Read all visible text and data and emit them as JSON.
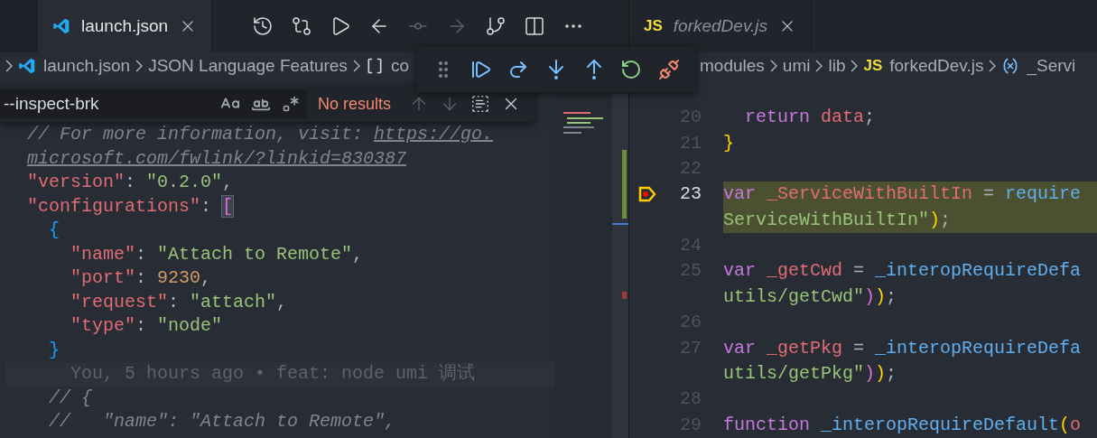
{
  "left_editor": {
    "tabs": [
      {
        "label": "launch.json",
        "selected": true,
        "preview": false
      }
    ],
    "actions": [
      {
        "kind": "history",
        "disabled": false
      },
      {
        "kind": "compare",
        "disabled": false
      },
      {
        "kind": "run",
        "disabled": false
      },
      {
        "kind": "back",
        "disabled": false
      },
      {
        "kind": "commit",
        "disabled": true
      },
      {
        "kind": "forward",
        "disabled": true
      },
      {
        "kind": "branch",
        "disabled": false
      },
      {
        "kind": "split",
        "disabled": false
      },
      {
        "kind": "more",
        "disabled": false
      }
    ],
    "breadcrumbs": [
      {
        "label": "launch.json",
        "kind": "file"
      },
      {
        "label": "JSON Language Features",
        "kind": "section"
      },
      {
        "label": "co",
        "kind": "symbol"
      }
    ],
    "find": {
      "value": "--inspect-brk",
      "match_case": false,
      "whole_word": false,
      "regex": false,
      "message": "No results",
      "prev_disabled": true,
      "next_disabled": true
    },
    "lines": [
      {
        "tokens": [
          {
            "kind": "comment",
            "text": "// For more information, visit: "
          },
          {
            "kind": "link",
            "text": "https://go."
          }
        ]
      },
      {
        "tokens": [
          {
            "kind": "link",
            "text": "microsoft.com/fwlink/?linkid=830387"
          }
        ]
      },
      {
        "tokens": [
          {
            "kind": "key",
            "text": "\"version\""
          },
          {
            "kind": "punct",
            "text": ": "
          },
          {
            "kind": "string",
            "text": "\"0.2.0\""
          },
          {
            "kind": "punct",
            "text": ","
          }
        ]
      },
      {
        "tokens": [
          {
            "kind": "key",
            "text": "\"configurations\""
          },
          {
            "kind": "punct",
            "text": ": "
          },
          {
            "kind": "match",
            "text": "["
          }
        ]
      },
      {
        "tokens": [
          {
            "kind": "brace",
            "text": "  {"
          }
        ]
      },
      {
        "tokens": [
          {
            "kind": "key",
            "text": "    \"name\""
          },
          {
            "kind": "punct",
            "text": ": "
          },
          {
            "kind": "string",
            "text": "\"Attach to Remote\""
          },
          {
            "kind": "punct",
            "text": ","
          }
        ]
      },
      {
        "tokens": [
          {
            "kind": "key",
            "text": "    \"port\""
          },
          {
            "kind": "punct",
            "text": ": "
          },
          {
            "kind": "number",
            "text": "9230"
          },
          {
            "kind": "punct",
            "text": ","
          }
        ]
      },
      {
        "tokens": [
          {
            "kind": "key",
            "text": "    \"request\""
          },
          {
            "kind": "punct",
            "text": ": "
          },
          {
            "kind": "string",
            "text": "\"attach\""
          },
          {
            "kind": "punct",
            "text": ","
          }
        ]
      },
      {
        "tokens": [
          {
            "kind": "key",
            "text": "    \"type\""
          },
          {
            "kind": "punct",
            "text": ": "
          },
          {
            "kind": "string",
            "text": "\"node\""
          }
        ]
      },
      {
        "tokens": [
          {
            "kind": "brace",
            "text": "  }"
          }
        ]
      },
      {
        "tokens": [
          {
            "kind": "blame",
            "text": "    You, 5 hours ago • feat: node umi 调试"
          }
        ]
      },
      {
        "tokens": [
          {
            "kind": "comment",
            "text": "  // {"
          }
        ]
      },
      {
        "tokens": [
          {
            "kind": "comment",
            "text": "  //   \"name\": \"Attach to Remote\","
          }
        ]
      }
    ]
  },
  "debug_toolbar": [
    {
      "kind": "grip"
    },
    {
      "kind": "continue"
    },
    {
      "kind": "step_over"
    },
    {
      "kind": "step_into"
    },
    {
      "kind": "step_out"
    },
    {
      "kind": "restart"
    },
    {
      "kind": "disconnect"
    }
  ],
  "right_editor": {
    "tabs": [
      {
        "label": "forkedDev.js",
        "selected": false,
        "preview": true,
        "icon_text": "JS"
      }
    ],
    "breadcrumbs": [
      {
        "label": "modules",
        "kind": "folder"
      },
      {
        "label": "umi",
        "kind": "folder"
      },
      {
        "label": "lib",
        "kind": "folder"
      },
      {
        "label": "forkedDev.js",
        "kind": "file",
        "icon_text": "JS"
      },
      {
        "label": "_Servi",
        "kind": "symbol"
      }
    ],
    "lines": [
      {
        "number": "20",
        "current": false,
        "rows": [
          {
            "tokens": [
              {
                "kind": "keyword",
                "text": "  return "
              },
              {
                "kind": "var",
                "text": "data"
              },
              {
                "kind": "punct",
                "text": ";"
              }
            ]
          }
        ]
      },
      {
        "number": "21",
        "current": false,
        "rows": [
          {
            "tokens": [
              {
                "kind": "bracket",
                "text": "}"
              }
            ]
          }
        ]
      },
      {
        "number": "22",
        "current": false,
        "rows": [
          {
            "tokens": []
          }
        ]
      },
      {
        "number": "23",
        "current": true,
        "breakpoint": true,
        "rows": [
          {
            "tokens": [
              {
                "kind": "keyword",
                "text": "var "
              },
              {
                "kind": "var",
                "text": "_ServiceWithBuiltIn"
              },
              {
                "kind": "punct",
                "text": " = "
              },
              {
                "kind": "func",
                "text": "require"
              }
            ]
          },
          {
            "tokens": [
              {
                "kind": "string",
                "text": "ServiceWithBuiltIn\""
              },
              {
                "kind": "bracket",
                "text": ")"
              },
              {
                "kind": "punct",
                "text": ";"
              }
            ]
          }
        ]
      },
      {
        "number": "24",
        "current": false,
        "rows": [
          {
            "tokens": []
          }
        ]
      },
      {
        "number": "25",
        "current": false,
        "rows": [
          {
            "tokens": [
              {
                "kind": "keyword",
                "text": "var "
              },
              {
                "kind": "var",
                "text": "_getCwd"
              },
              {
                "kind": "punct",
                "text": " = "
              },
              {
                "kind": "func",
                "text": "_interopRequireDefa"
              }
            ]
          },
          {
            "tokens": [
              {
                "kind": "string",
                "text": "utils/getCwd\""
              },
              {
                "kind": "bracket2",
                "text": ")"
              },
              {
                "kind": "bracket",
                "text": ")"
              },
              {
                "kind": "punct",
                "text": ";"
              }
            ]
          }
        ]
      },
      {
        "number": "26",
        "current": false,
        "rows": [
          {
            "tokens": []
          }
        ]
      },
      {
        "number": "27",
        "current": false,
        "rows": [
          {
            "tokens": [
              {
                "kind": "keyword",
                "text": "var "
              },
              {
                "kind": "var",
                "text": "_getPkg"
              },
              {
                "kind": "punct",
                "text": " = "
              },
              {
                "kind": "func",
                "text": "_interopRequireDefa"
              }
            ]
          },
          {
            "tokens": [
              {
                "kind": "string",
                "text": "utils/getPkg\""
              },
              {
                "kind": "bracket2",
                "text": ")"
              },
              {
                "kind": "bracket",
                "text": ")"
              },
              {
                "kind": "punct",
                "text": ";"
              }
            ]
          }
        ]
      },
      {
        "number": "28",
        "current": false,
        "rows": [
          {
            "tokens": []
          }
        ]
      },
      {
        "number": "29",
        "current": false,
        "rows": [
          {
            "tokens": [
              {
                "kind": "keyword",
                "text": "function "
              },
              {
                "kind": "func",
                "text": "_interopRequireDefault"
              },
              {
                "kind": "bracket",
                "text": "("
              },
              {
                "kind": "var",
                "text": "o"
              }
            ]
          }
        ]
      }
    ]
  }
}
